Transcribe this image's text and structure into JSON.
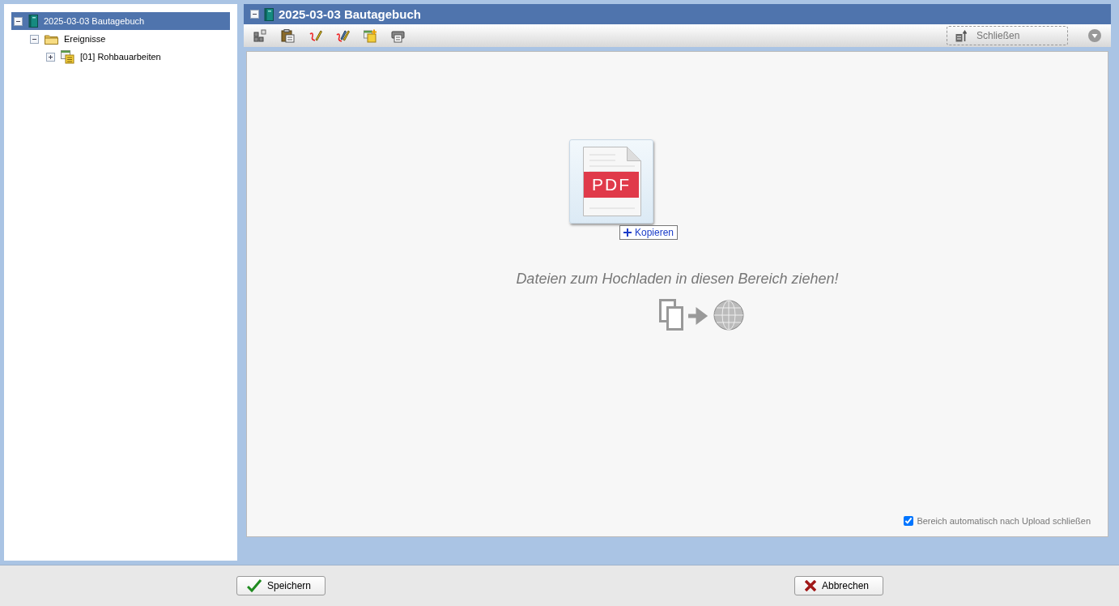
{
  "tree": [
    {
      "label": "2025-03-03 Bautagebuch",
      "kind": "book",
      "expanded": true,
      "selected": true,
      "children": [
        {
          "label": "Ereignisse",
          "kind": "folder",
          "expanded": true,
          "selected": false,
          "children": [
            {
              "label": "[01] Rohbauarbeiten",
              "kind": "event",
              "expanded": false,
              "selected": false
            }
          ]
        }
      ]
    }
  ],
  "panel": {
    "title": "2025-03-03 Bautagebuch",
    "expanded": true,
    "close_button": "Schließen"
  },
  "drop_zone": {
    "drag_file_label": "PDF",
    "drag_action": "Kopieren",
    "hint": "Dateien zum Hochladen in diesen Bereich ziehen!",
    "auto_close": {
      "label": "Bereich automatisch nach Upload schließen",
      "checked": true
    }
  },
  "buttons": [
    {
      "label": "Speichern",
      "kind": "ok"
    },
    {
      "label": "Abbrechen",
      "kind": "cancel"
    }
  ]
}
